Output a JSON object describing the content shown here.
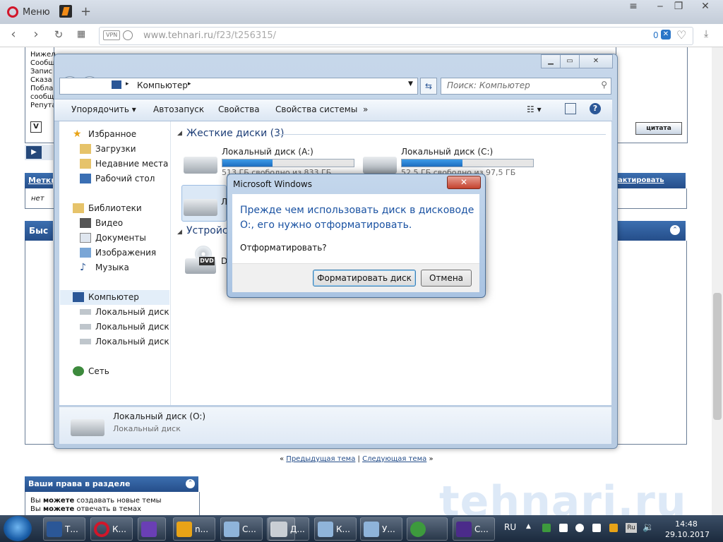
{
  "browser": {
    "menu_label": "Меню",
    "url_host": "www.tehnari.ru",
    "url_path": "/f23/t256315/",
    "vpn_label": "VPN",
    "adblock_count": "0"
  },
  "forum": {
    "left_lines": [
      "Нижел",
      "Сообщ",
      "Запис",
      "Сказа",
      "Побла",
      "сообщ",
      "Репута"
    ],
    "tags_label": "Метки",
    "tags_value": "нет",
    "edit_tags": "актировать метки",
    "quick_label": "Быс",
    "quote_label": "цитата",
    "prev_topic": "Предыдущая тема",
    "next_topic": "Следующая тема",
    "rights_title": "Ваши права в разделе",
    "rights_1_a": "Вы ",
    "rights_1_b": "можете",
    "rights_1_c": " создавать новые темы",
    "rights_2_a": "Вы ",
    "rights_2_b": "можете",
    "rights_2_c": " отвечать в темах",
    "watermark": "tehnari.ru"
  },
  "explorer": {
    "breadcrumb": "Компьютер",
    "search_placeholder": "Поиск: Компьютер",
    "toolbar": {
      "organize": "Упорядочить",
      "autorun": "Автозапуск",
      "properties": "Свойства",
      "system_properties": "Свойства системы",
      "more": "»"
    },
    "nav": {
      "favorites": "Избранное",
      "downloads": "Загрузки",
      "recent": "Недавние места",
      "desktop": "Рабочий стол",
      "libraries": "Библиотеки",
      "video": "Видео",
      "documents": "Документы",
      "images": "Изображения",
      "music": "Музыка",
      "computer": "Компьютер",
      "disk_a": "Локальный диск (A",
      "disk_c": "Локальный диск (C",
      "disk_o": "Локальный диск (O",
      "network": "Сеть"
    },
    "hdd_group": "Жесткие диски (3)",
    "removable_group": "Устройс",
    "disk_a_name": "Локальный диск (A:)",
    "disk_a_free": "513 ГБ свободно из 833 ГБ",
    "disk_a_used_fraction": 0.38,
    "disk_c_name": "Локальный диск (C:)",
    "disk_c_free": "52,5 ГБ свободно из 97,5 ГБ",
    "disk_c_used_fraction": 0.46,
    "disk_o_partial": "Л",
    "dvd_partial": "D",
    "dvd_label": "DVD",
    "details_name": "Локальный диск (O:)",
    "details_type": "Локальный диск"
  },
  "dialog": {
    "title": "Microsoft Windows",
    "close": "✕",
    "message": "Прежде чем использовать диск в дисководе O:, его нужно отформатировать.",
    "question": "Отформатировать?",
    "format_button": "Форматировать диск",
    "cancel_button": "Отмена"
  },
  "taskbar": {
    "items": [
      "Т...",
      "К...",
      "",
      "n...",
      "С...",
      "",
      "Д...",
      "К...",
      "У...",
      "",
      "С..."
    ],
    "lang_main": "RU",
    "lang_tray": "Ru",
    "time": "14:48",
    "date": "29.10.2017"
  },
  "colors": {
    "accent_blue": "#1a52a2",
    "progress": "#1e6fc2",
    "opera_red": "#d2162a"
  }
}
